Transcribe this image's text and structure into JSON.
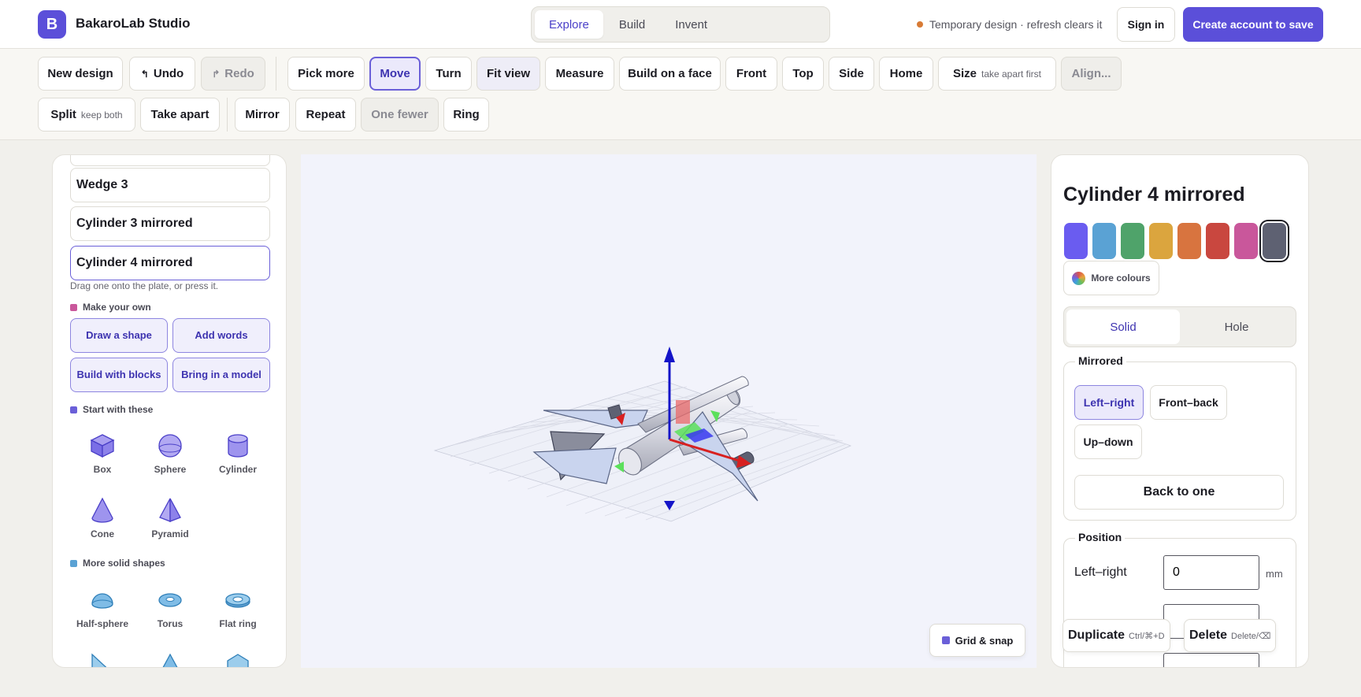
{
  "app": {
    "logo_letter": "B",
    "title": "BakaroLab Studio"
  },
  "mode_tabs": [
    {
      "label": "Explore",
      "active": true
    },
    {
      "label": "Build",
      "active": false
    },
    {
      "label": "Invent",
      "active": false
    }
  ],
  "header": {
    "temp_note": "Temporary design · refresh clears it",
    "signin_label": "Sign in",
    "create_label": "Create account to save"
  },
  "toolbar": {
    "new_design": "New design",
    "undo": "Undo",
    "redo": "Redo",
    "pick_more": "Pick more",
    "move": "Move",
    "turn": "Turn",
    "fit_view": "Fit view",
    "measure": "Measure",
    "build_on_face": "Build on a face",
    "front": "Front",
    "top": "Top",
    "side": "Side",
    "home": "Home",
    "size": "Size",
    "size_sub": "take apart first",
    "align": "Align...",
    "split": "Split",
    "split_sub": "keep both",
    "take_apart": "Take apart",
    "mirror": "Mirror",
    "repeat": "Repeat",
    "one_fewer": "One fewer",
    "ring": "Ring"
  },
  "left_panel": {
    "items": [
      "Wedge 3",
      "Cylinder 3 mirrored",
      "Cylinder 4 mirrored"
    ],
    "hint": "Drag one onto the plate, or press it.",
    "make_own": {
      "title": "Make your own",
      "buttons": [
        "Draw a shape",
        "Add words",
        "Build with blocks",
        "Bring in a model"
      ]
    },
    "start": {
      "title": "Start with these",
      "shapes": [
        "Box",
        "Sphere",
        "Cylinder",
        "Cone",
        "Pyramid"
      ]
    },
    "more": {
      "title": "More solid shapes",
      "shapes": [
        "Half-sphere",
        "Torus",
        "Flat ring"
      ]
    },
    "colors": {
      "make_own": "#c9579b",
      "start": "#6a5fd8",
      "more": "#5aa2d4"
    }
  },
  "viewport": {
    "grid_snap_label": "Grid & snap"
  },
  "right_panel": {
    "title": "Cylinder 4 mirrored",
    "swatches": [
      "#6a5cf0",
      "#5aa2d4",
      "#4fa36a",
      "#dba53e",
      "#d8743f",
      "#c9473f",
      "#c9579b",
      "#5e6172"
    ],
    "selected_swatch": 7,
    "more_colours": "More colours",
    "mode": {
      "solid": "Solid",
      "hole": "Hole",
      "active": "Solid"
    },
    "mirrored": {
      "legend": "Mirrored",
      "left_right": "Left–right",
      "front_back": "Front–back",
      "up_down": "Up–down",
      "selected": "Left–right",
      "back_to_one": "Back to one"
    },
    "position": {
      "legend": "Position",
      "left_right_label": "Left–right",
      "left_right_value": "0",
      "unit": "mm"
    },
    "duplicate": {
      "label": "Duplicate",
      "shortcut": "Ctrl/⌘+D"
    },
    "delete": {
      "label": "Delete",
      "shortcut": "Delete/⌫"
    }
  }
}
